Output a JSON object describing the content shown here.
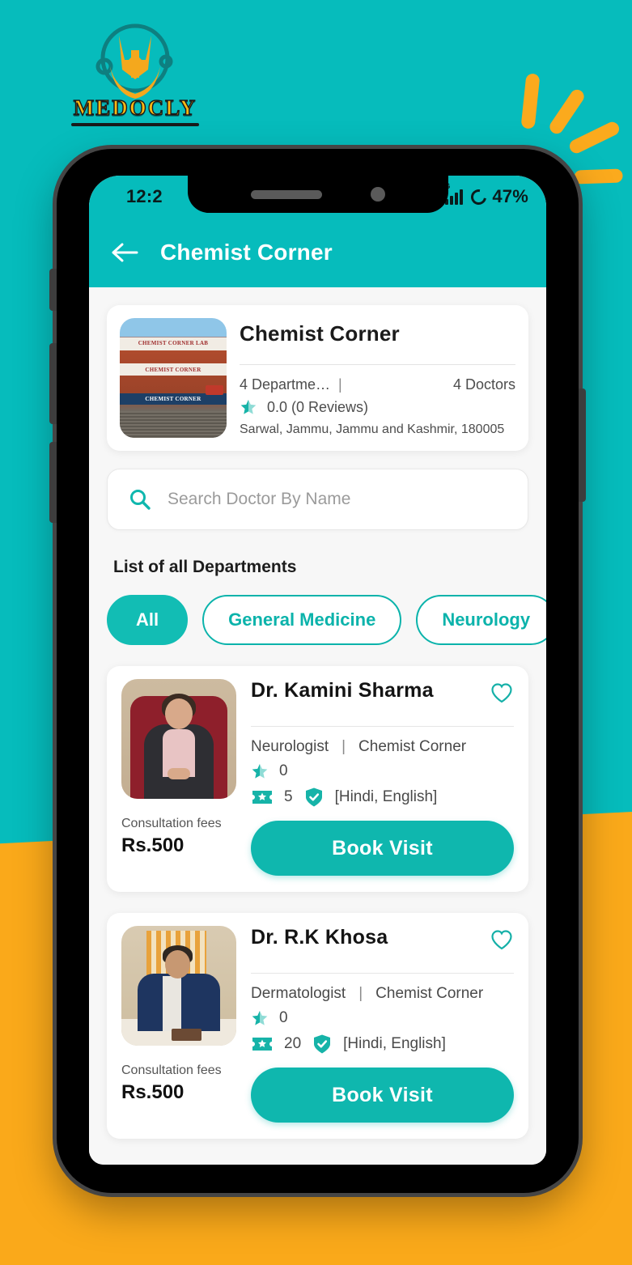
{
  "brand": {
    "logo_word": "MEDOCLY",
    "logo_icon": "medical-caduceus-logo",
    "teal": "#06bcbc",
    "orange": "#faa91a",
    "accent": "#0fb7ae"
  },
  "status_bar": {
    "time": "12:2",
    "network_label": "G",
    "battery_percent": "47%",
    "signal_icon": "signal-bars-icon",
    "battery_icon": "battery-ring-icon"
  },
  "appbar": {
    "back_icon": "back-arrow-icon",
    "title": "Chemist Corner"
  },
  "clinic": {
    "photo_alt": "chemist-corner-building-photo",
    "name": "Chemist Corner",
    "departments": "4 Departme…",
    "separator": "|",
    "doctors": "4 Doctors",
    "rating_icon": "star-icon",
    "rating": "0.0 (0 Reviews)",
    "address": "Sarwal, Jammu, Jammu and Kashmir, 180005"
  },
  "search": {
    "icon": "search-icon",
    "placeholder": "Search Doctor By Name",
    "value": ""
  },
  "departments": {
    "title": "List of all Departments",
    "chips": [
      {
        "label": "All",
        "active": true
      },
      {
        "label": "General Medicine",
        "active": false
      },
      {
        "label": "Neurology",
        "active": false
      }
    ]
  },
  "doctors": [
    {
      "photo_alt": "dr-kamini-sharma-photo",
      "name": "Dr. Kamini Sharma",
      "favorite_icon": "heart-outline-icon",
      "specialty": "Neurologist",
      "separator": "|",
      "clinic": "Chemist Corner",
      "rating_icon": "star-icon",
      "rating": "0",
      "experience_icon": "ticket-star-icon",
      "experience": "5",
      "verified_icon": "shield-check-icon",
      "languages": "[Hindi, English]",
      "fees_label": "Consultation fees",
      "fees_value": "Rs.500",
      "book_label": "Book Visit"
    },
    {
      "photo_alt": "dr-rk-khosa-photo",
      "name": "Dr. R.K Khosa",
      "favorite_icon": "heart-outline-icon",
      "specialty": "Dermatologist",
      "separator": "|",
      "clinic": "Chemist Corner",
      "rating_icon": "star-icon",
      "rating": "0",
      "experience_icon": "ticket-star-icon",
      "experience": "20",
      "verified_icon": "shield-check-icon",
      "languages": "[Hindi, English]",
      "fees_label": "Consultation fees",
      "fees_value": "Rs.500",
      "book_label": "Book Visit"
    }
  ]
}
